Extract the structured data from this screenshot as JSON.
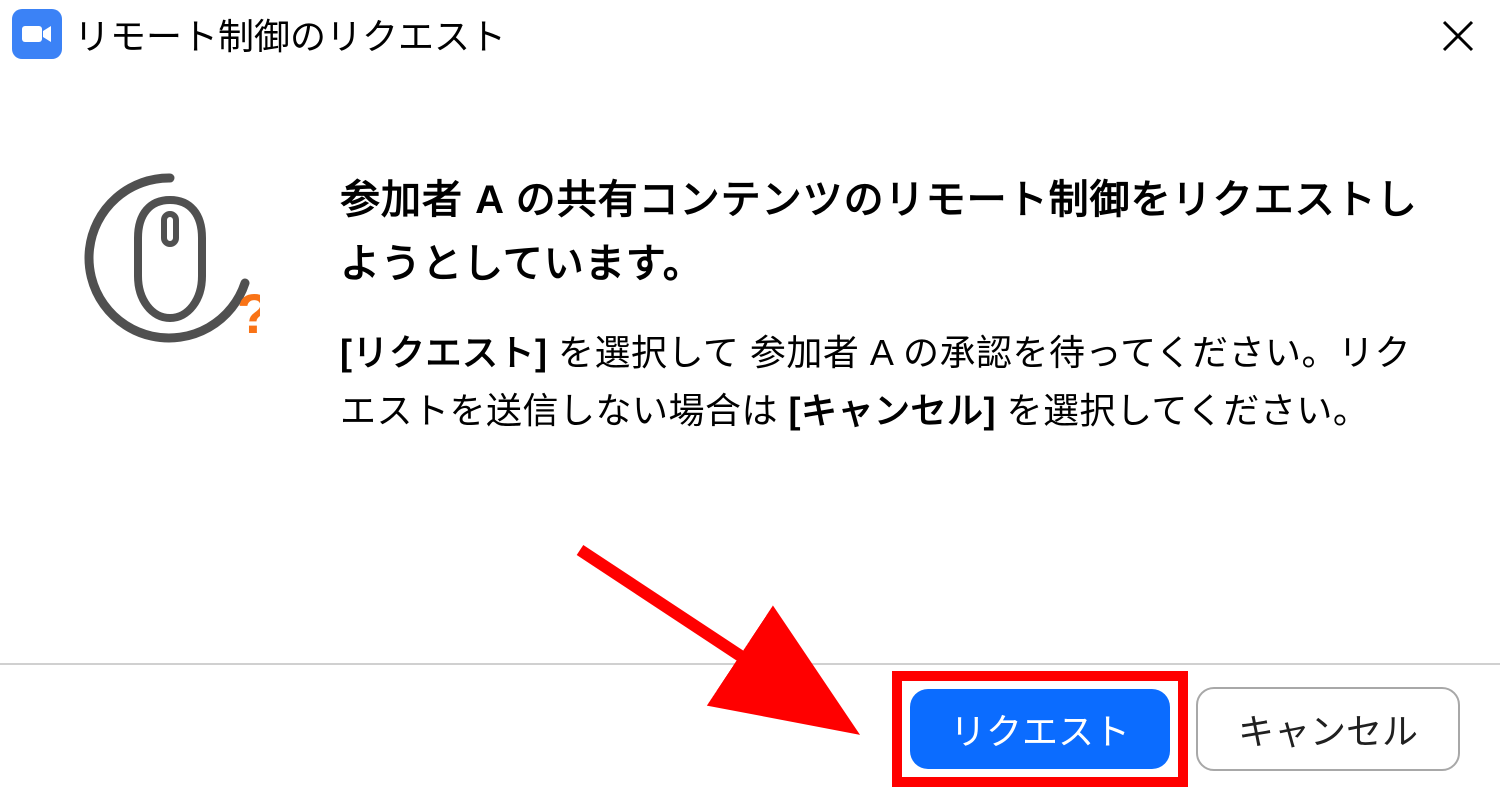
{
  "titlebar": {
    "title": "リモート制御のリクエスト"
  },
  "dialog": {
    "main_message": "参加者 A の共有コンテンツのリモート制御をリクエストしようとしています。",
    "sub_message_1_bold": "[リクエスト]",
    "sub_message_1_rest": " を選択して 参加者 A の承認を待ってください。リクエストを送信しない場合は ",
    "sub_message_2_bold": "[キャンセル]",
    "sub_message_2_rest": " を選択してください。"
  },
  "buttons": {
    "request": "リクエスト",
    "cancel": "キャンセル"
  },
  "colors": {
    "primary": "#0b6cff",
    "annotation": "#ff0000",
    "question_mark": "#f97316"
  }
}
